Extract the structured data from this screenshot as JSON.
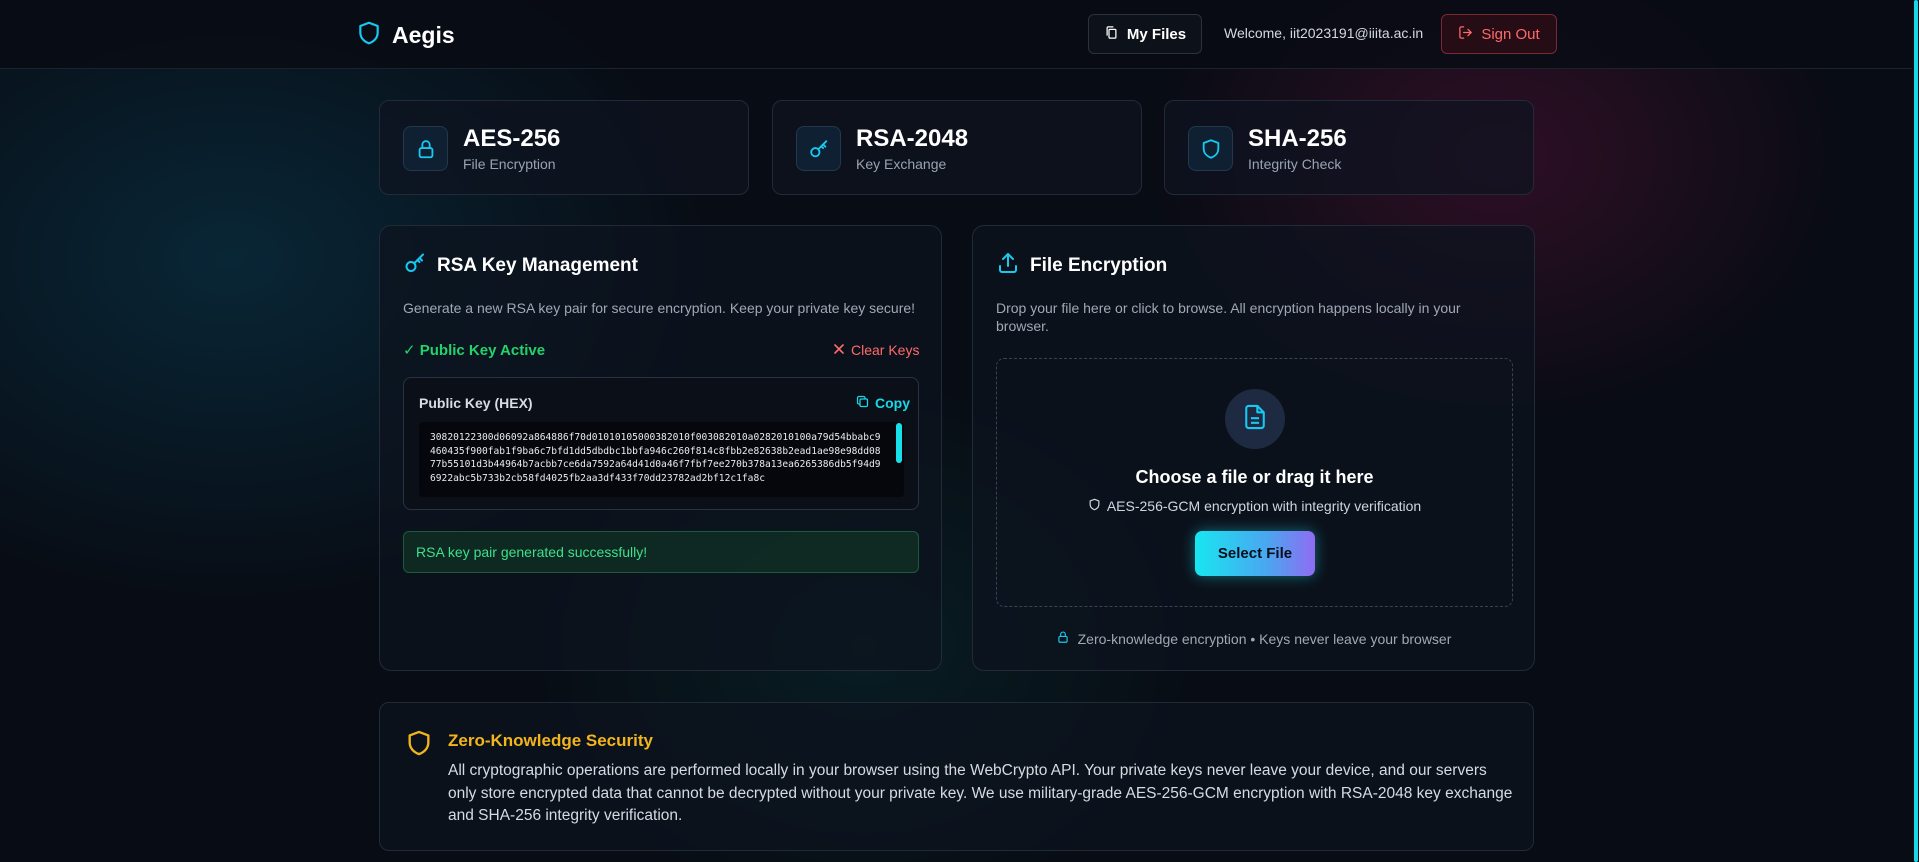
{
  "header": {
    "brand": "Aegis",
    "my_files_label": "My Files",
    "welcome_text": "Welcome, iit2023191@iiita.ac.in",
    "sign_out_label": "Sign Out"
  },
  "stats": [
    {
      "title": "AES-256",
      "subtitle": "File Encryption",
      "icon": "lock-icon"
    },
    {
      "title": "RSA-2048",
      "subtitle": "Key Exchange",
      "icon": "key-icon"
    },
    {
      "title": "SHA-256",
      "subtitle": "Integrity Check",
      "icon": "shield-icon"
    }
  ],
  "rsa_panel": {
    "title": "RSA Key Management",
    "description": "Generate a new RSA key pair for secure encryption. Keep your private key secure!",
    "status": "✓ Public Key Active",
    "clear_label": "Clear Keys",
    "key_label": "Public Key (HEX)",
    "copy_label": "Copy",
    "public_key_hex": "30820122300d06092a864886f70d01010105000382010f003082010a0282010100a79d54bbabc9460435f900fab1f9ba6c7bfd1dd5dbdbc1bbfa946c260f814c8fbb2e82638b2ead1ae98e98dd0877b55101d3b44964b7acbb7ce6da7592a64d41d0a46f7fbf7ee270b378a13ea6265386db5f94d96922abc5b733b2cb58fd4025fb2aa3df433f70dd23782ad2bf12c1fa8c",
    "success_message": "RSA key pair generated successfully!"
  },
  "encrypt_panel": {
    "title": "File Encryption",
    "description": "Drop your file here or click to browse. All encryption happens locally in your browser.",
    "drop_title": "Choose a file or drag it here",
    "drop_subtitle": "AES-256-GCM encryption with integrity verification",
    "select_label": "Select File",
    "note": "Zero-knowledge encryption • Keys never leave your browser"
  },
  "security": {
    "title": "Zero-Knowledge Security",
    "text": "All cryptographic operations are performed locally in your browser using the WebCrypto API. Your private keys never leave your device, and our servers only store encrypted data that cannot be decrypted without your private key. We use military-grade AES-256-GCM encryption with RSA-2048 key exchange and SHA-256 integrity verification."
  },
  "colors": {
    "accent": "#18d8e8",
    "success": "#22d36a",
    "danger": "#ff6a6a",
    "warning": "#f2b51c",
    "background": "#080c14"
  }
}
